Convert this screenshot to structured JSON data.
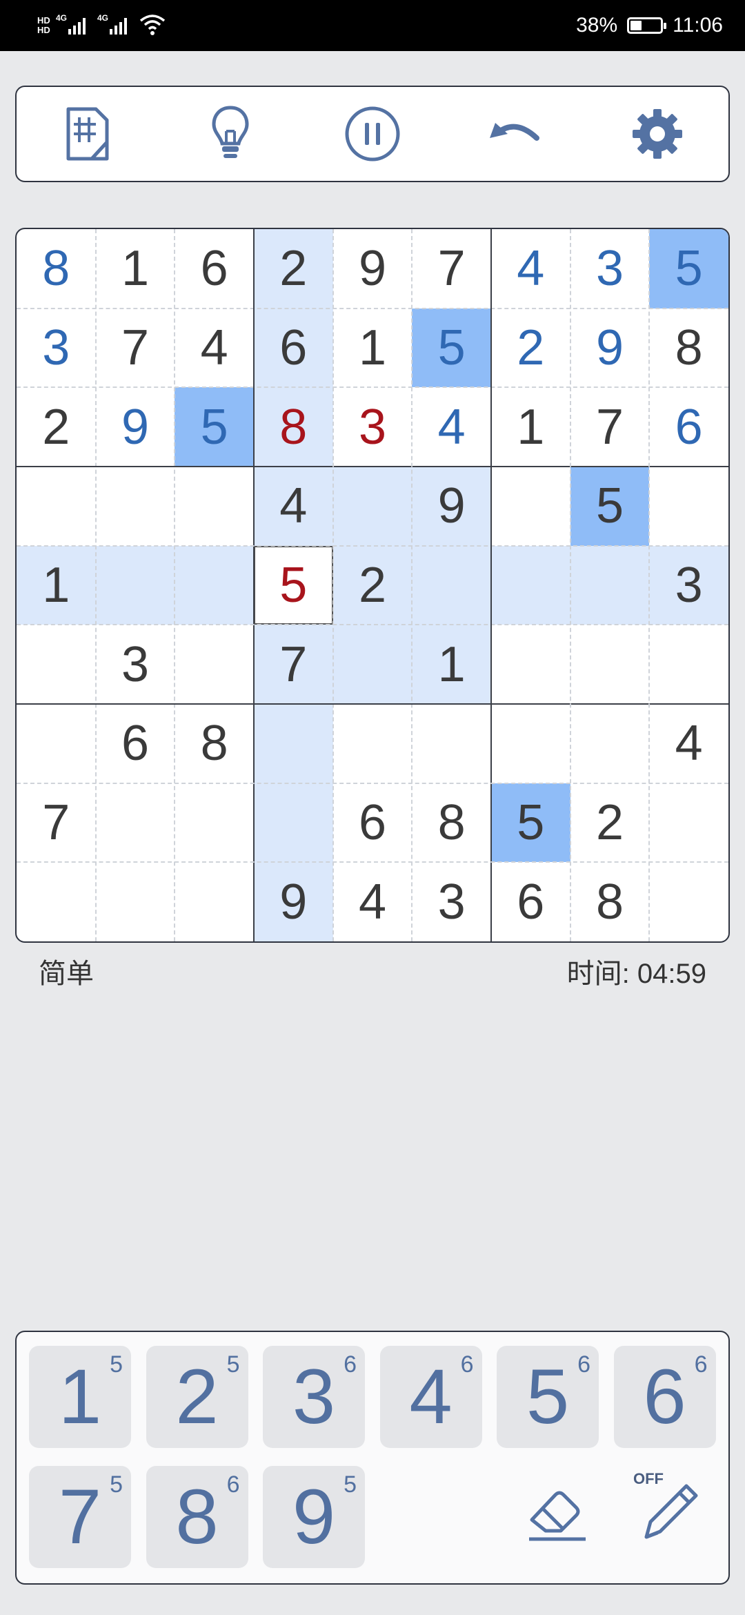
{
  "status_bar": {
    "hd1": "HD",
    "hd2": "HD",
    "net1": "4G",
    "net2": "4G",
    "battery_percent": "38%",
    "battery_level": 0.38,
    "time": "11:06"
  },
  "toolbar": {
    "icons": [
      "notes-grid-icon",
      "hint-bulb-icon",
      "pause-icon",
      "undo-icon",
      "settings-gear-icon"
    ]
  },
  "board": {
    "rows": [
      [
        "8",
        "1",
        "6",
        "2",
        "9",
        "7",
        "4",
        "3",
        "5"
      ],
      [
        "3",
        "7",
        "4",
        "6",
        "1",
        "5",
        "2",
        "9",
        "8"
      ],
      [
        "2",
        "9",
        "5",
        "8",
        "3",
        "4",
        "1",
        "7",
        "6"
      ],
      [
        "",
        "",
        "",
        "4",
        "",
        "9",
        "",
        "5",
        ""
      ],
      [
        "1",
        "",
        "",
        "5",
        "2",
        "",
        "",
        "",
        "3"
      ],
      [
        "",
        "3",
        "",
        "7",
        "",
        "1",
        "",
        "",
        ""
      ],
      [
        "",
        "6",
        "8",
        "",
        "",
        "",
        "",
        "",
        "4"
      ],
      [
        "7",
        "",
        "",
        "",
        "6",
        "8",
        "5",
        "2",
        ""
      ],
      [
        "",
        "",
        "",
        "9",
        "4",
        "3",
        "6",
        "8",
        ""
      ]
    ],
    "styles": [
      [
        "blue",
        "given",
        "given",
        "given",
        "given",
        "given",
        "blue",
        "blue",
        "blue"
      ],
      [
        "blue",
        "given",
        "given",
        "given",
        "given",
        "blue",
        "blue",
        "blue",
        "given"
      ],
      [
        "given",
        "blue",
        "blue",
        "red",
        "red",
        "blue",
        "given",
        "given",
        "blue"
      ],
      [
        "given",
        "given",
        "given",
        "given",
        "given",
        "given",
        "given",
        "given",
        "given"
      ],
      [
        "given",
        "given",
        "given",
        "red",
        "given",
        "given",
        "given",
        "given",
        "given"
      ],
      [
        "given",
        "given",
        "given",
        "given",
        "given",
        "given",
        "given",
        "given",
        "given"
      ],
      [
        "given",
        "given",
        "given",
        "given",
        "given",
        "given",
        "given",
        "given",
        "given"
      ],
      [
        "given",
        "given",
        "given",
        "given",
        "given",
        "given",
        "given",
        "given",
        "given"
      ],
      [
        "given",
        "given",
        "given",
        "given",
        "given",
        "given",
        "given",
        "given",
        "given"
      ]
    ],
    "selected": [
      4,
      3
    ],
    "same_number_cells": [
      [
        0,
        8
      ],
      [
        1,
        5
      ],
      [
        2,
        2
      ],
      [
        3,
        7
      ],
      [
        7,
        6
      ]
    ],
    "colors": {
      "given": "#3a3a3a",
      "user": "#2f68b3",
      "conflict": "#a8141c",
      "highlight": "#dbe8fb",
      "same_number": "#8fbcf7"
    }
  },
  "info": {
    "difficulty": "简单",
    "timer_label": "时间:",
    "timer_value": "04:59"
  },
  "keypad": {
    "keys": [
      {
        "num": "1",
        "count": "5"
      },
      {
        "num": "2",
        "count": "5"
      },
      {
        "num": "3",
        "count": "6"
      },
      {
        "num": "4",
        "count": "6"
      },
      {
        "num": "5",
        "count": "6"
      },
      {
        "num": "6",
        "count": "6"
      },
      {
        "num": "7",
        "count": "5"
      },
      {
        "num": "8",
        "count": "6"
      },
      {
        "num": "9",
        "count": "5"
      }
    ],
    "eraser_icon": "eraser-icon",
    "pencil_icon": "pencil-icon",
    "pencil_state": "OFF"
  }
}
